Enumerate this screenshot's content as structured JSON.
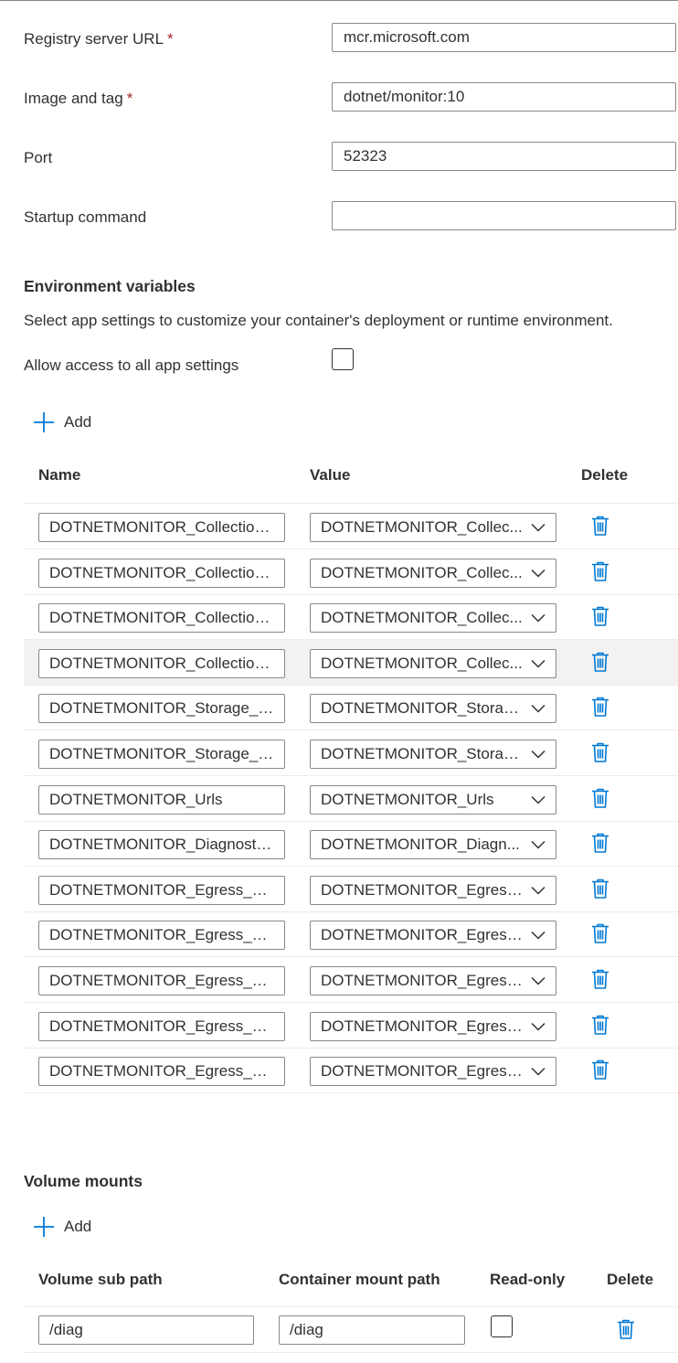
{
  "form": {
    "registry_label": "Registry server URL",
    "registry_value": "mcr.microsoft.com",
    "image_label": "Image and tag",
    "image_value": "dotnet/monitor:10",
    "port_label": "Port",
    "port_value": "52323",
    "startup_label": "Startup command",
    "startup_value": "",
    "required_mark": "*"
  },
  "env": {
    "title": "Environment variables",
    "description": "Select app settings to customize your container's deployment or runtime environment.",
    "allow_label": "Allow access to all app settings",
    "allow_checked": false,
    "add_label": "Add",
    "columns": {
      "name": "Name",
      "value": "Value",
      "delete": "Delete"
    },
    "rows": [
      {
        "name": "DOTNETMONITOR_Collection...",
        "value": "DOTNETMONITOR_Collec..."
      },
      {
        "name": "DOTNETMONITOR_Collection...",
        "value": "DOTNETMONITOR_Collec..."
      },
      {
        "name": "DOTNETMONITOR_Collection...",
        "value": "DOTNETMONITOR_Collec..."
      },
      {
        "name": "DOTNETMONITOR_Collection...",
        "value": "DOTNETMONITOR_Collec..."
      },
      {
        "name": "DOTNETMONITOR_Storage__...",
        "value": "DOTNETMONITOR_Storag..."
      },
      {
        "name": "DOTNETMONITOR_Storage__...",
        "value": "DOTNETMONITOR_Storag..."
      },
      {
        "name": "DOTNETMONITOR_Urls",
        "value": "DOTNETMONITOR_Urls"
      },
      {
        "name": "DOTNETMONITOR_Diagnostic...",
        "value": "DOTNETMONITOR_Diagn..."
      },
      {
        "name": "DOTNETMONITOR_Egress__A...",
        "value": "DOTNETMONITOR_Egress..."
      },
      {
        "name": "DOTNETMONITOR_Egress__A...",
        "value": "DOTNETMONITOR_Egress..."
      },
      {
        "name": "DOTNETMONITOR_Egress__A...",
        "value": "DOTNETMONITOR_Egress..."
      },
      {
        "name": "DOTNETMONITOR_Egress__A...",
        "value": "DOTNETMONITOR_Egress..."
      },
      {
        "name": "DOTNETMONITOR_Egress__Pr...",
        "value": "DOTNETMONITOR_Egress..."
      }
    ]
  },
  "volumes": {
    "title": "Volume mounts",
    "add_label": "Add",
    "columns": {
      "sub_path": "Volume sub path",
      "mount_path": "Container mount path",
      "read_only": "Read-only",
      "delete": "Delete"
    },
    "rows": [
      {
        "sub_path": "/diag",
        "mount_path": "/diag",
        "read_only": false
      }
    ]
  },
  "colors": {
    "accent": "#0078d4",
    "required": "#a4262c",
    "border": "#8a8886",
    "divider": "#edebe9",
    "row_hover": "#f3f2f1"
  }
}
